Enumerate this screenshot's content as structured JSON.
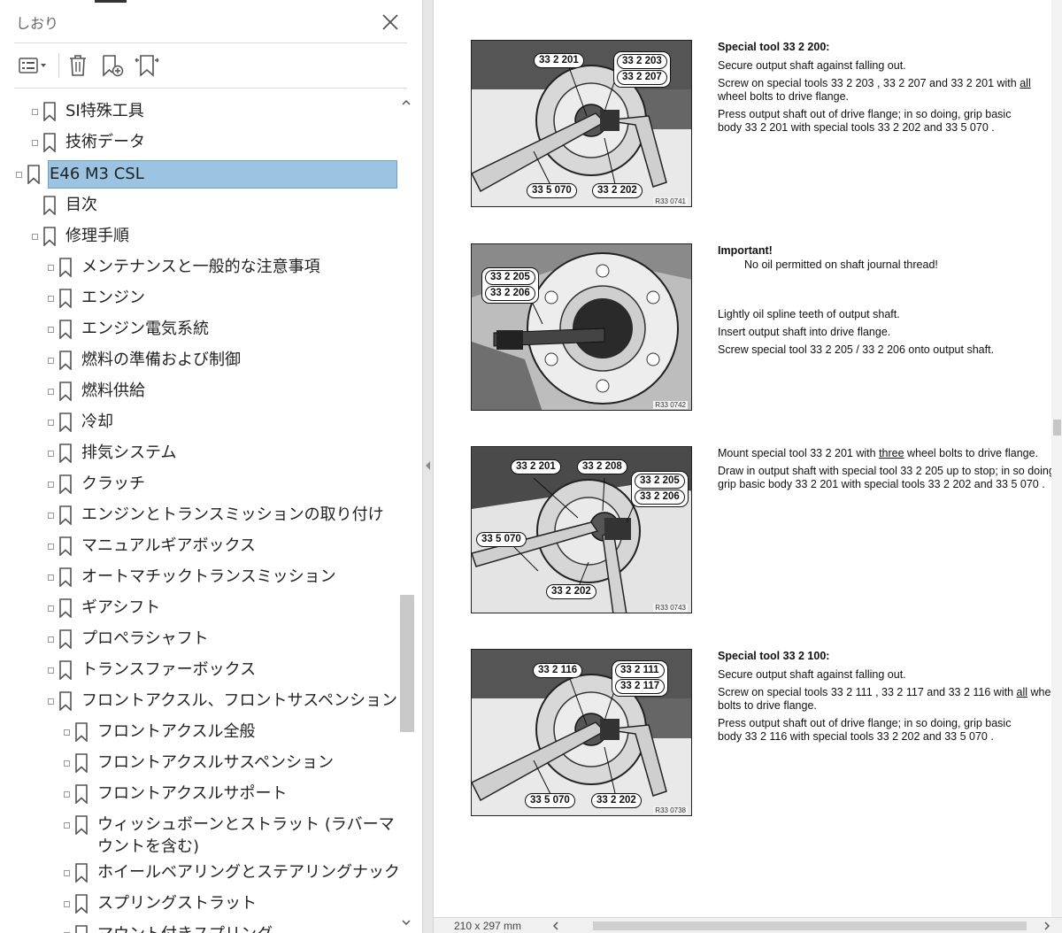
{
  "bookmarks_panel": {
    "title": "しおり",
    "tree": [
      {
        "label": "SI特殊工具",
        "level": 1,
        "expandable": true
      },
      {
        "label": "技術データ",
        "level": 1,
        "expandable": true
      },
      {
        "label": "E46 M3 CSL",
        "level": 0,
        "expandable": true,
        "selected": true
      },
      {
        "label": "目次",
        "level": 1,
        "expandable": false
      },
      {
        "label": "修理手順",
        "level": 1,
        "expandable": true
      },
      {
        "label": "メンテナンスと一般的な注意事項",
        "level": 2,
        "expandable": true
      },
      {
        "label": "エンジン",
        "level": 2,
        "expandable": true
      },
      {
        "label": "エンジン電気系統",
        "level": 2,
        "expandable": true
      },
      {
        "label": "燃料の準備および制御",
        "level": 2,
        "expandable": true
      },
      {
        "label": "燃料供給",
        "level": 2,
        "expandable": true
      },
      {
        "label": "冷却",
        "level": 2,
        "expandable": true
      },
      {
        "label": "排気システム",
        "level": 2,
        "expandable": true
      },
      {
        "label": "クラッチ",
        "level": 2,
        "expandable": true
      },
      {
        "label": "エンジンとトランスミッションの取り付け",
        "level": 2,
        "expandable": true
      },
      {
        "label": "マニュアルギアボックス",
        "level": 2,
        "expandable": true
      },
      {
        "label": "オートマチックトランスミッション",
        "level": 2,
        "expandable": true
      },
      {
        "label": "ギアシフト",
        "level": 2,
        "expandable": true
      },
      {
        "label": "プロペラシャフト",
        "level": 2,
        "expandable": true
      },
      {
        "label": "トランスファーボックス",
        "level": 2,
        "expandable": true
      },
      {
        "label": "フロントアクスル、フロントサスペンション",
        "level": 2,
        "expandable": true
      },
      {
        "label": "フロントアクスル全般",
        "level": 3,
        "expandable": true
      },
      {
        "label": "フロントアクスルサスペンション",
        "level": 3,
        "expandable": true
      },
      {
        "label": "フロントアクスルサポート",
        "level": 3,
        "expandable": true
      },
      {
        "label": "ウィッシュボーンとストラット (ラバーマウントを含む)",
        "level": 3,
        "expandable": true,
        "wrap": true
      },
      {
        "label": "ホイールベアリングとステアリングナックル",
        "level": 3,
        "expandable": true
      },
      {
        "label": "スプリングストラット",
        "level": 3,
        "expandable": true
      },
      {
        "label": "マウント付きスプリング",
        "level": 3,
        "expandable": true
      }
    ]
  },
  "document": {
    "figures": [
      {
        "ref": "R33 0741",
        "callouts": [
          {
            "label": "33 2 201"
          },
          {
            "stack": [
              "33 2 203",
              "33 2 207"
            ]
          },
          {
            "label": "33 5 070"
          },
          {
            "label": "33 2 202"
          }
        ]
      },
      {
        "ref": "R33 0742",
        "callouts": [
          {
            "stack": [
              "33 2 205",
              "33 2 206"
            ]
          }
        ]
      },
      {
        "ref": "R33 0743",
        "callouts": [
          {
            "label": "33 2 201"
          },
          {
            "label": "33 2 208"
          },
          {
            "stack": [
              "33 2 205",
              "33 2 206"
            ]
          },
          {
            "label": "33 5 070"
          },
          {
            "label": "33 2 202"
          }
        ]
      },
      {
        "ref": "R33 0738",
        "callouts": [
          {
            "label": "33 2 116"
          },
          {
            "stack": [
              "33 2 111",
              "33 2 117"
            ]
          },
          {
            "label": "33 5 070"
          },
          {
            "label": "33 2 202"
          }
        ]
      }
    ],
    "blocks": [
      {
        "heading": "Special tool 33 2 200:",
        "p1": "Secure output shaft against falling out.",
        "p2a": "Screw on special tools  33 2 203 ,  33 2 207 and  33 2 201 with ",
        "p2u": "all",
        "p2b": " wheel bolts to drive flange.",
        "p3": "Press output shaft out of drive flange; in so doing, grip basic body  33 2 201 with special tools  33 2 202 and  33 5 070 ."
      },
      {
        "heading": "Important!",
        "note": "No oil permitted on shaft journal thread!",
        "p1": "Lightly oil spline teeth of output shaft.",
        "p2": "Insert output shaft into drive flange.",
        "p3": "Screw special tool  33 2 205 /  33 2 206 onto output shaft."
      },
      {
        "p1a": "Mount special tool  33 2 201 with ",
        "p1u": "three",
        "p1b": " wheel bolts to drive flange.",
        "p2": "Draw in output shaft with special tool  33 2 205 up to stop; in so doing, grip basic body  33 2 201 with special tools  33 2 202 and  33 5 070 ."
      },
      {
        "heading": "Special tool 33 2 100:",
        "p1": "Secure output shaft against falling out.",
        "p2a": "Screw on special tools  33 2 111 ,  33 2 117 and  33 2 116 with ",
        "p2u": "all",
        "p2b": " wheel bolts to drive flange.",
        "p3": "Press output shaft out of drive flange; in so doing, grip basic body  33 2 116 with special tools  33 2 202 and  33 5 070 ."
      }
    ]
  },
  "statusbar": {
    "page_size": "210 x 297 mm"
  }
}
